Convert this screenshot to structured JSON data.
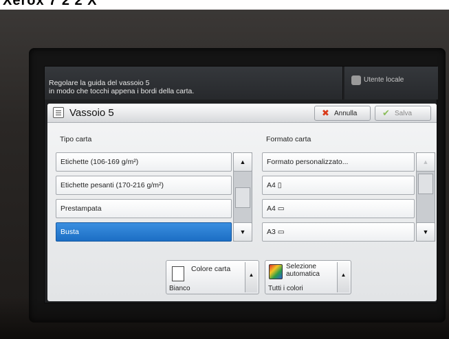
{
  "caption": "Xerox 7 2 2 X",
  "message": {
    "line1": "Regolare la guida del vassoio 5",
    "line2": "in modo che tocchi appena i bordi della carta."
  },
  "user": {
    "label": "Utente locale"
  },
  "header": {
    "title": "Vassoio 5",
    "cancel_label": "Annulla",
    "save_label": "Salva"
  },
  "paper_type": {
    "label": "Tipo carta",
    "items": [
      "Etichette (106-169 g/m²)",
      "Etichette pesanti (170-216 g/m²)",
      "Prestampata",
      "Busta"
    ],
    "selected": "Busta"
  },
  "paper_size": {
    "label": "Formato carta",
    "items": [
      "Formato personalizzato...",
      "A4 ▯",
      "A4 ▭",
      "A3 ▭"
    ]
  },
  "paper_color": {
    "title": "Colore carta",
    "value": "Bianco"
  },
  "color_mode": {
    "title_line1": "Selezione",
    "title_line2": "automatica",
    "value": "Tutti i colori"
  },
  "colors": {
    "selection_blue": "#1c6ec4",
    "cancel_red": "#d93a1a",
    "save_green": "#8bbd5a"
  }
}
